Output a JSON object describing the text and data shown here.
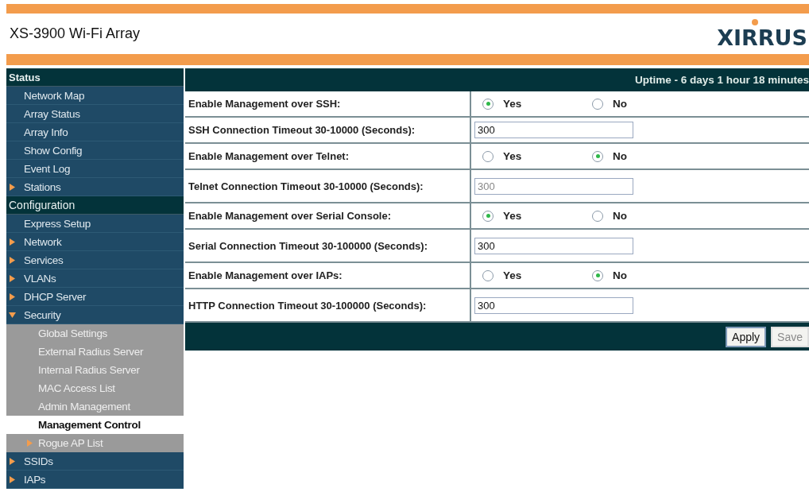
{
  "header": {
    "title": "XS-3900 Wi-Fi Array",
    "logo": "XIRRUS"
  },
  "sidebar": [
    {
      "title": "Status",
      "items": [
        {
          "label": "Network Map",
          "kind": "link",
          "selected": false
        },
        {
          "label": "Array Status",
          "kind": "link",
          "selected": false
        },
        {
          "label": "Array Info",
          "kind": "link",
          "selected": false
        },
        {
          "label": "Show Config",
          "kind": "link",
          "selected": false
        },
        {
          "label": "Event Log",
          "kind": "link",
          "selected": false
        },
        {
          "label": "Stations",
          "kind": "folder",
          "expanded": false,
          "selected": false
        }
      ]
    },
    {
      "title": "Configuration",
      "items": [
        {
          "label": "Express Setup",
          "kind": "link",
          "selected": false
        },
        {
          "label": "Network",
          "kind": "folder",
          "expanded": false,
          "selected": false
        },
        {
          "label": "Services",
          "kind": "folder",
          "expanded": false,
          "selected": false
        },
        {
          "label": "VLANs",
          "kind": "folder",
          "expanded": false,
          "selected": false
        },
        {
          "label": "DHCP Server",
          "kind": "folder",
          "expanded": false,
          "selected": false
        },
        {
          "label": "Security",
          "kind": "folder",
          "expanded": true,
          "selected": false,
          "children": [
            {
              "label": "Global Settings",
              "kind": "link",
              "selected": false
            },
            {
              "label": "External Radius Server",
              "kind": "link",
              "selected": false
            },
            {
              "label": "Internal Radius Server",
              "kind": "link",
              "selected": false
            },
            {
              "label": "MAC Access List",
              "kind": "link",
              "selected": false
            },
            {
              "label": "Admin Management",
              "kind": "link",
              "selected": false
            },
            {
              "label": "Management Control",
              "kind": "link",
              "selected": true
            },
            {
              "label": "Rogue AP List",
              "kind": "folder",
              "expanded": false,
              "selected": false
            }
          ]
        },
        {
          "label": "SSIDs",
          "kind": "folder",
          "expanded": false,
          "selected": false
        },
        {
          "label": "IAPs",
          "kind": "folder",
          "expanded": false,
          "selected": false
        }
      ]
    }
  ],
  "uptime": "Uptime - 6 days 1 hour 18 minutes",
  "form": [
    {
      "kind": "radio",
      "label": "Enable Management over SSH:",
      "options": [
        {
          "label": "Yes",
          "selected": true
        },
        {
          "label": "No",
          "selected": false
        }
      ]
    },
    {
      "kind": "text",
      "label": "SSH Connection Timeout 30-10000 (Seconds):",
      "value": "300",
      "disabled": false
    },
    {
      "kind": "radio",
      "label": "Enable Management over Telnet:",
      "options": [
        {
          "label": "Yes",
          "selected": false
        },
        {
          "label": "No",
          "selected": true
        }
      ]
    },
    {
      "kind": "text",
      "label": "Telnet Connection Timeout 30-10000 (Seconds):",
      "value": "300",
      "disabled": true
    },
    {
      "kind": "radio",
      "label": "Enable Management over Serial Console:",
      "options": [
        {
          "label": "Yes",
          "selected": true
        },
        {
          "label": "No",
          "selected": false
        }
      ]
    },
    {
      "kind": "text",
      "label": "Serial Connection Timeout 30-100000 (Seconds):",
      "value": "300",
      "disabled": false
    },
    {
      "kind": "radio",
      "label": "Enable Management over IAPs:",
      "options": [
        {
          "label": "Yes",
          "selected": false
        },
        {
          "label": "No",
          "selected": true
        }
      ]
    },
    {
      "kind": "text",
      "label": "HTTP Connection Timeout 30-100000 (Seconds):",
      "value": "300",
      "disabled": false
    }
  ],
  "buttons": [
    {
      "label": "Apply",
      "disabled": false
    },
    {
      "label": "Save",
      "disabled": true
    }
  ]
}
